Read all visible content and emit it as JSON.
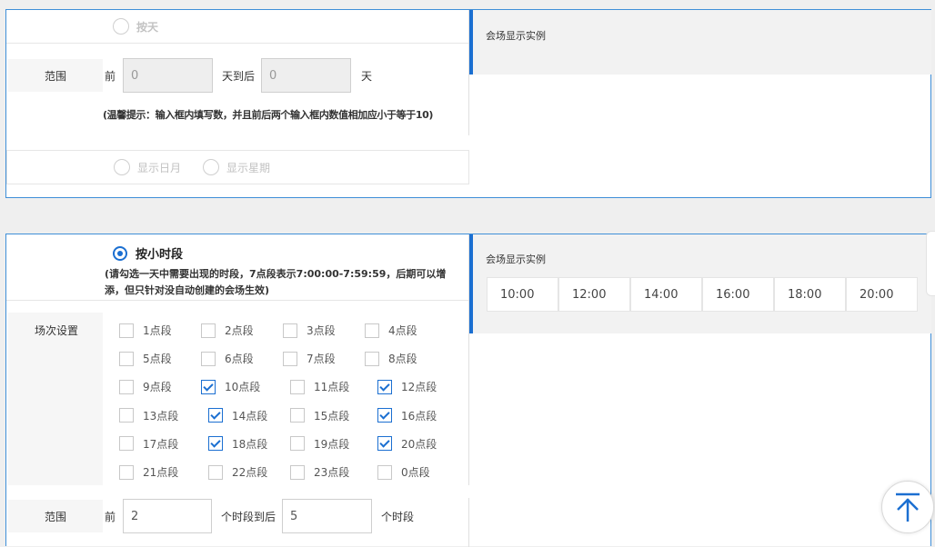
{
  "colors": {
    "accent": "#1b6fd1",
    "panel_border": "#3f8fd8",
    "label_bg": "#f6f6f6"
  },
  "section1": {
    "radio_label": "按天",
    "range_label": "范围",
    "prefix_label": "前",
    "before_value": "0",
    "middle_label": "天到后",
    "after_value": "0",
    "suffix_label": "天",
    "hint": "(温馨提示：输入框内填写数，并且前后两个输入框内数值相加应小于等于10)",
    "display_date_label": "显示日月",
    "display_week_label": "显示星期",
    "preview_title": "会场显示实例"
  },
  "section2": {
    "radio_label": "按小时段",
    "hint": "(请勾选一天中需要出现的时段，7点段表示7:00:00-7:59:59，后期可以增添，但只针对没自动创建的会场生效)",
    "session_label": "场次设置",
    "slots": [
      {
        "label": "1点段",
        "checked": false
      },
      {
        "label": "2点段",
        "checked": false
      },
      {
        "label": "3点段",
        "checked": false
      },
      {
        "label": "4点段",
        "checked": false
      },
      {
        "label": "5点段",
        "checked": false
      },
      {
        "label": "6点段",
        "checked": false
      },
      {
        "label": "7点段",
        "checked": false
      },
      {
        "label": "8点段",
        "checked": false
      },
      {
        "label": "9点段",
        "checked": false
      },
      {
        "label": "10点段",
        "checked": true
      },
      {
        "label": "11点段",
        "checked": false
      },
      {
        "label": "12点段",
        "checked": true
      },
      {
        "label": "13点段",
        "checked": false
      },
      {
        "label": "14点段",
        "checked": true
      },
      {
        "label": "15点段",
        "checked": false
      },
      {
        "label": "16点段",
        "checked": true
      },
      {
        "label": "17点段",
        "checked": false
      },
      {
        "label": "18点段",
        "checked": true
      },
      {
        "label": "19点段",
        "checked": false
      },
      {
        "label": "20点段",
        "checked": true
      },
      {
        "label": "21点段",
        "checked": false
      },
      {
        "label": "22点段",
        "checked": false
      },
      {
        "label": "23点段",
        "checked": false
      },
      {
        "label": "0点段",
        "checked": false
      }
    ],
    "range_label": "范围",
    "prefix_label": "前",
    "before_value": "2",
    "middle_label": "个时段到后",
    "after_value": "5",
    "suffix_label": "个时段",
    "preview_title": "会场显示实例",
    "preview_times": [
      "10:00",
      "12:00",
      "14:00",
      "16:00",
      "18:00",
      "20:00"
    ]
  },
  "icons": {
    "back_to_top": "arrow-up-icon"
  }
}
